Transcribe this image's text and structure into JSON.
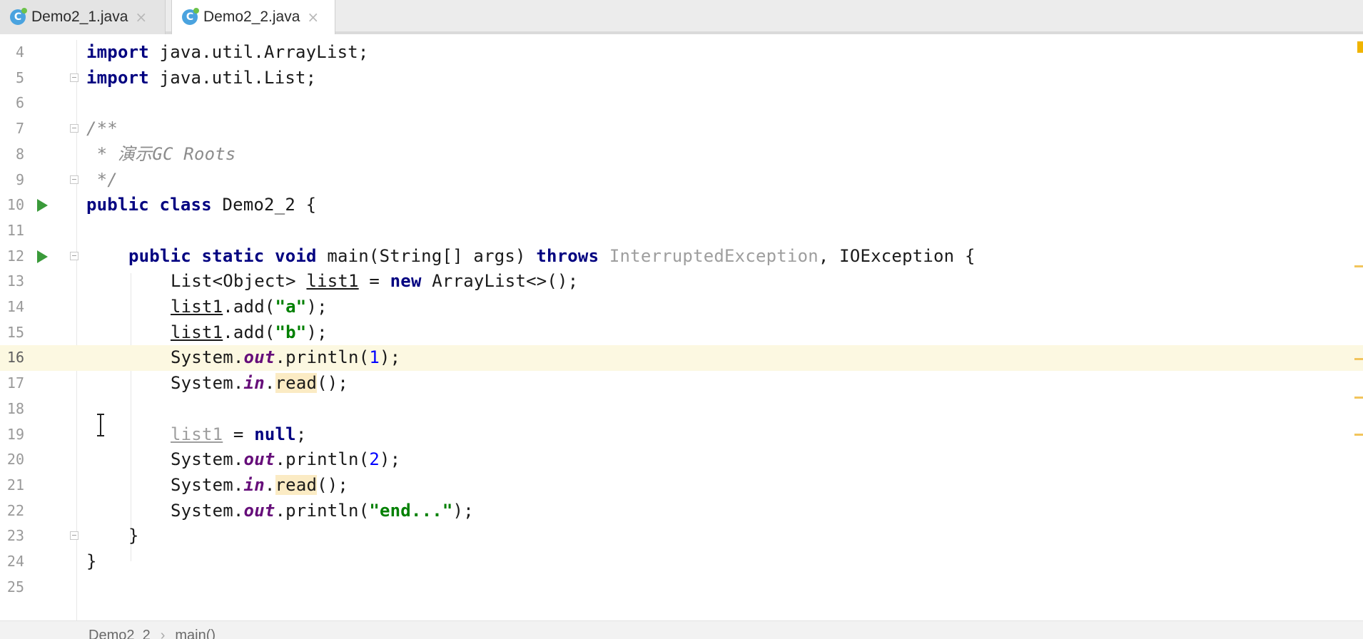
{
  "tabs": [
    {
      "label": "Demo2_1.java",
      "icon": "java-class-icon",
      "active": false
    },
    {
      "label": "Demo2_2.java",
      "icon": "java-class-icon",
      "active": true
    }
  ],
  "tab_close_glyph": "×",
  "file_icon_letter": "C",
  "editor": {
    "line_numbers": [
      "4",
      "5",
      "6",
      "7",
      "8",
      "9",
      "10",
      "11",
      "12",
      "13",
      "14",
      "15",
      "16",
      "17",
      "18",
      "19",
      "20",
      "21",
      "22",
      "23",
      "24",
      "25"
    ],
    "current_line": "16",
    "code": {
      "l4": {
        "kw": "import",
        "rest": " java.util.ArrayList;"
      },
      "l5": {
        "kw": "import",
        "rest": " java.util.List;"
      },
      "l7": "/**",
      "l8": " * 演示GC Roots",
      "l9": " */",
      "l10": {
        "kw": "public class",
        "rest": " Demo2_2 {"
      },
      "l12": {
        "kw1": "public static void",
        "mid": " main(String[] args) ",
        "kw2": "throws",
        "unused": " InterruptedException",
        "rest": ", IOException {"
      },
      "l13": {
        "a": "List<Object> ",
        "var": "list1",
        "b": " = ",
        "kw": "new",
        "c": " ArrayList<>();"
      },
      "l14": {
        "var": "list1",
        "a": ".add(",
        "str": "\"a\"",
        "b": ");"
      },
      "l15": {
        "var": "list1",
        "a": ".add(",
        "str": "\"b\"",
        "b": ");"
      },
      "l16": {
        "a": "System.",
        "stat": "out",
        "b": ".println(",
        "num": "1",
        "c": ");"
      },
      "l17": {
        "a": "System.",
        "stat": "in",
        "b": ".",
        "hl": "read",
        "c": "();"
      },
      "l19": {
        "var": "list1",
        "a": " = ",
        "kw": "null",
        "b": ";"
      },
      "l20": {
        "a": "System.",
        "stat": "out",
        "b": ".println(",
        "num": "2",
        "c": ");"
      },
      "l21": {
        "a": "System.",
        "stat": "in",
        "b": ".",
        "hl": "read",
        "c": "();"
      },
      "l22": {
        "a": "System.",
        "stat": "out",
        "b": ".println(",
        "str": "\"end...\"",
        "c": ");"
      },
      "l23": "}",
      "l24": "}"
    }
  },
  "breadcrumb": {
    "class": "Demo2_2",
    "separator": "›",
    "method": "main()"
  },
  "colors": {
    "keyword": "#000080",
    "string": "#008000",
    "number": "#0000ff",
    "static_field": "#660e7a",
    "comment": "#8c8c8c",
    "current_line_bg": "#fcf8e1",
    "run_icon": "#3a9a3a"
  }
}
